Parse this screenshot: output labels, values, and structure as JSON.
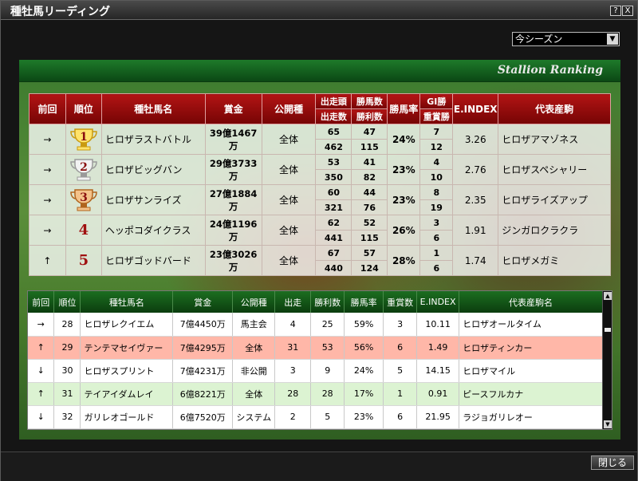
{
  "window": {
    "title": "種牡馬リーディング",
    "help_label": "?",
    "close_label": "X"
  },
  "season_select": {
    "value": "今シーズン",
    "arrow": "▼"
  },
  "banner": {
    "text": "Stallion Ranking"
  },
  "top_table": {
    "headers": {
      "prev": "前回",
      "rank": "順位",
      "name": "種牡馬名",
      "prize": "賞金",
      "race_type": "公開種",
      "starters": "出走頭",
      "starts": "出走数",
      "winners": "勝馬数",
      "wins": "勝利数",
      "win_rate": "勝馬率",
      "g1": "GI勝",
      "graded": "重賞勝",
      "eindex": "E.INDEX",
      "progeny": "代表産駒"
    },
    "rows": [
      {
        "prev": "→",
        "rank": "1",
        "trophy": "gold",
        "name": "ヒロザラストバトル",
        "prize": "39億1467万",
        "race_type": "全体",
        "starters": "65",
        "starts": "462",
        "winners": "47",
        "wins": "115",
        "win_rate": "24%",
        "g1": "7",
        "graded": "12",
        "eindex": "3.26",
        "progeny": "ヒロザアマゾネス"
      },
      {
        "prev": "→",
        "rank": "2",
        "trophy": "silver",
        "name": "ヒロザビッグバン",
        "prize": "29億3733万",
        "race_type": "全体",
        "starters": "53",
        "starts": "350",
        "winners": "41",
        "wins": "82",
        "win_rate": "23%",
        "g1": "4",
        "graded": "10",
        "eindex": "2.76",
        "progeny": "ヒロザスペシャリー"
      },
      {
        "prev": "→",
        "rank": "3",
        "trophy": "bronze",
        "name": "ヒロザサンライズ",
        "prize": "27億1884万",
        "race_type": "全体",
        "starters": "60",
        "starts": "321",
        "winners": "44",
        "wins": "76",
        "win_rate": "23%",
        "g1": "8",
        "graded": "19",
        "eindex": "2.35",
        "progeny": "ヒロザライズアップ"
      },
      {
        "prev": "→",
        "rank": "4",
        "trophy": "",
        "name": "ヘッポコダイクラス",
        "prize": "24億1196万",
        "race_type": "全体",
        "starters": "62",
        "starts": "441",
        "winners": "52",
        "wins": "115",
        "win_rate": "26%",
        "g1": "3",
        "graded": "6",
        "eindex": "1.91",
        "progeny": "ジンガロクラクラ"
      },
      {
        "prev": "↑",
        "rank": "5",
        "trophy": "",
        "name": "ヒロザゴッドバード",
        "prize": "23億3026万",
        "race_type": "全体",
        "starters": "67",
        "starts": "440",
        "winners": "57",
        "wins": "124",
        "win_rate": "28%",
        "g1": "1",
        "graded": "6",
        "eindex": "1.74",
        "progeny": "ヒロザメガミ"
      }
    ]
  },
  "list_table": {
    "headers": {
      "prev": "前回",
      "rank": "順位",
      "name": "種牡馬名",
      "prize": "賞金",
      "race_type": "公開種",
      "starts": "出走",
      "wins": "勝利数",
      "win_rate": "勝馬率",
      "graded": "重賞数",
      "eindex": "E.INDEX",
      "progeny": "代表産駒名"
    },
    "rows": [
      {
        "prev": "→",
        "rank": "28",
        "name": "ヒロザレクイエム",
        "prize": "7億4450万",
        "race_type": "馬主会",
        "starts": "4",
        "wins": "25",
        "win_rate": "59%",
        "graded": "3",
        "eindex": "10.11",
        "progeny": "ヒロザオールタイム"
      },
      {
        "prev": "↑",
        "rank": "29",
        "name": "テンテマセイヴァー",
        "prize": "7億4295万",
        "race_type": "全体",
        "starts": "31",
        "wins": "53",
        "win_rate": "56%",
        "graded": "6",
        "eindex": "1.49",
        "progeny": "ヒロザティンカー"
      },
      {
        "prev": "↓",
        "rank": "30",
        "name": "ヒロザスプリント",
        "prize": "7億4231万",
        "race_type": "非公開",
        "starts": "3",
        "wins": "9",
        "win_rate": "24%",
        "graded": "5",
        "eindex": "14.15",
        "progeny": "ヒロザマイル"
      },
      {
        "prev": "↑",
        "rank": "31",
        "name": "テイアイダムレイ",
        "prize": "6億8221万",
        "race_type": "全体",
        "starts": "28",
        "wins": "28",
        "win_rate": "17%",
        "graded": "1",
        "eindex": "0.91",
        "progeny": "ピースフルカナ"
      },
      {
        "prev": "↓",
        "rank": "32",
        "name": "ガリレオゴールド",
        "prize": "6億7520万",
        "race_type": "システム",
        "starts": "2",
        "wins": "5",
        "win_rate": "23%",
        "graded": "6",
        "eindex": "21.95",
        "progeny": "ラジョガリレオー"
      }
    ]
  },
  "close_button": {
    "label": "閉じる"
  },
  "colors": {
    "header_red": "#b21414",
    "header_green": "#1c6e20",
    "highlight_row": "#ffb7a8",
    "green_row": "#dcf3d2"
  }
}
